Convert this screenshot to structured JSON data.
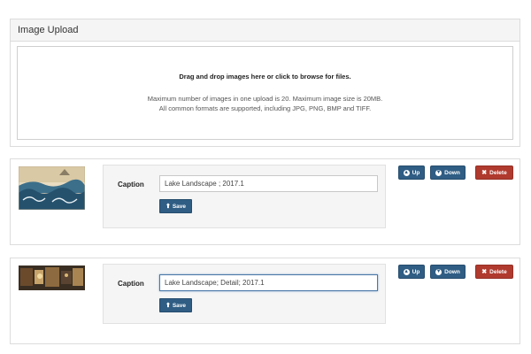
{
  "upload": {
    "title": "Image Upload",
    "drop_title": "Drag and drop images here or click to browse for files.",
    "limit_text": "Maximum number of images in one upload is 20. Maximum image size is 20MB.",
    "formats_text": "All common formats are supported, including JPG, PNG, BMP and TIFF."
  },
  "images": [
    {
      "caption_label": "Caption",
      "caption_value": "Lake Landscape ; 2017.1",
      "save_label": "Save",
      "up_label": "Up",
      "down_label": "Down",
      "delete_label": "Delete"
    },
    {
      "caption_label": "Caption",
      "caption_value": "Lake Landscape; Detail; 2017.1",
      "save_label": "Save",
      "up_label": "Up",
      "down_label": "Down",
      "delete_label": "Delete"
    }
  ],
  "colors": {
    "primary": "#2f5d84",
    "danger": "#b03a2e",
    "panel_heading_bg": "#f5f5f5"
  },
  "icons": {
    "save": "upload-icon",
    "up": "arrow-up-circle-icon",
    "down": "arrow-down-circle-icon",
    "delete": "close-icon"
  }
}
